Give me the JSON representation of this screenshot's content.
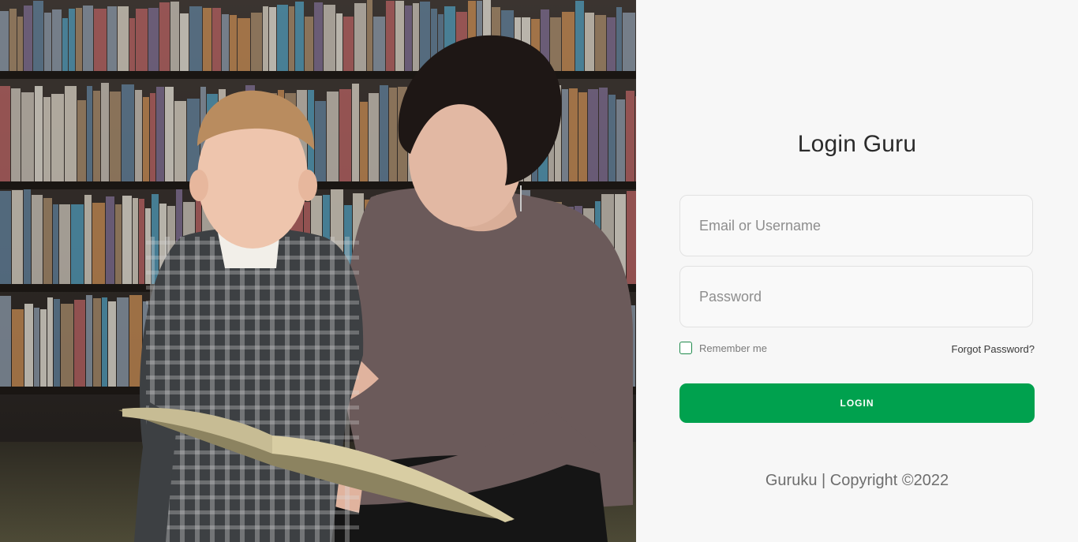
{
  "login": {
    "title": "Login Guru",
    "email_placeholder": "Email or Username",
    "password_placeholder": "Password",
    "remember_label": "Remember me",
    "forgot_label": "Forgot Password?",
    "login_button_label": "LOGIN",
    "footer": "Guruku | Copyright ©2022"
  },
  "colors": {
    "accent": "#00a14e",
    "panel_background": "#f7f7f7"
  },
  "photo": {
    "subject": "woman reading a book to a young boy in a library"
  }
}
